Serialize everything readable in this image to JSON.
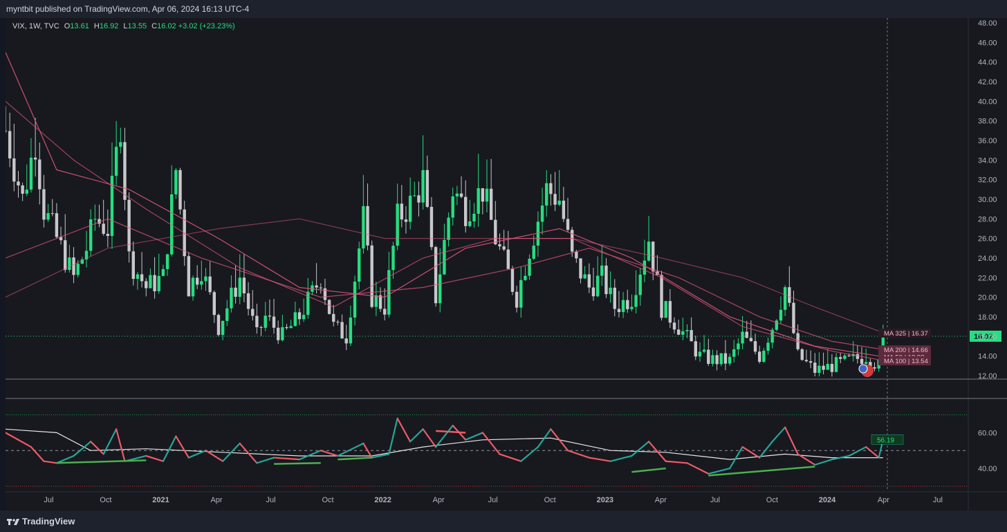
{
  "header": {
    "publish_line": "myntbit published on TradingView.com, Apr 06, 2024 16:13 UTC-4"
  },
  "legend": {
    "symbol": "VIX, 1W, TVC",
    "o_label": "O",
    "o_value": "13.61",
    "h_label": "H",
    "h_value": "16.92",
    "l_label": "L",
    "l_value": "13.55",
    "c_label": "C",
    "c_value": "16.02",
    "change": "+3.02 (+23.23%)"
  },
  "footer": {
    "brand": "TradingView"
  },
  "colors": {
    "bull": "#26de81",
    "bear": "#c8c8cc",
    "rsi_up": "#26a69a",
    "rsi_down": "#f05a67",
    "ma_line": "#e2557c",
    "price_line": "#26de81",
    "background": "#17191e"
  },
  "chart_data": [
    {
      "type": "candlestick",
      "title": "VIX, 1W, TVC",
      "y_ticks": [
        "12.00",
        "14.00",
        "16.00",
        "18.00",
        "20.00",
        "22.00",
        "24.00",
        "26.00",
        "28.00",
        "30.00",
        "32.00",
        "34.00",
        "36.00",
        "38.00",
        "40.00",
        "42.00",
        "44.00",
        "46.00",
        "48.00"
      ],
      "ylim": [
        11.5,
        48.5
      ],
      "x_ticks": [
        "Jul",
        "Oct",
        "2021",
        "Apr",
        "Jul",
        "Oct",
        "2022",
        "Apr",
        "Jul",
        "Oct",
        "2023",
        "Apr",
        "Jul",
        "Oct",
        "2024",
        "Apr",
        "Jul"
      ],
      "x_range": [
        "2020-04-20",
        "2024-08-19"
      ],
      "last_price": "16.02",
      "ma_labels": [
        {
          "name": "MA 325",
          "value": "16.37"
        },
        {
          "name": "MA 200",
          "value": "14.66"
        },
        {
          "name": "MA 50",
          "value": "13.93"
        },
        {
          "name": "MA 100",
          "value": "13.54"
        }
      ],
      "close_path": [
        [
          "2020-04-20",
          37
        ],
        [
          "2020-05-18",
          30
        ],
        [
          "2020-06-08",
          36
        ],
        [
          "2020-06-22",
          29
        ],
        [
          "2020-07-13",
          26
        ],
        [
          "2020-08-10",
          22
        ],
        [
          "2020-08-31",
          25
        ],
        [
          "2020-09-14",
          28
        ],
        [
          "2020-10-05",
          27
        ],
        [
          "2020-10-26",
          38
        ],
        [
          "2020-11-09",
          24
        ],
        [
          "2020-12-07",
          21
        ],
        [
          "2021-01-04",
          22
        ],
        [
          "2021-01-25",
          33
        ],
        [
          "2021-02-15",
          21
        ],
        [
          "2021-03-08",
          23
        ],
        [
          "2021-04-05",
          17
        ],
        [
          "2021-05-10",
          22
        ],
        [
          "2021-06-07",
          16
        ],
        [
          "2021-06-21",
          18
        ],
        [
          "2021-07-19",
          16
        ],
        [
          "2021-08-16",
          18
        ],
        [
          "2021-09-20",
          22
        ],
        [
          "2021-10-11",
          17
        ],
        [
          "2021-11-01",
          16
        ],
        [
          "2021-11-29",
          28
        ],
        [
          "2021-12-13",
          20
        ],
        [
          "2022-01-03",
          19
        ],
        [
          "2022-01-24",
          28
        ],
        [
          "2022-02-21",
          30
        ],
        [
          "2022-03-07",
          32
        ],
        [
          "2022-03-28",
          20
        ],
        [
          "2022-04-25",
          31
        ],
        [
          "2022-05-16",
          29
        ],
        [
          "2022-06-13",
          31
        ],
        [
          "2022-07-04",
          26
        ],
        [
          "2022-08-08",
          20
        ],
        [
          "2022-08-29",
          25
        ],
        [
          "2022-09-26",
          31
        ],
        [
          "2022-10-17",
          30
        ],
        [
          "2022-11-07",
          24
        ],
        [
          "2022-12-05",
          21
        ],
        [
          "2022-12-26",
          22
        ],
        [
          "2023-01-16",
          19
        ],
        [
          "2023-02-13",
          20
        ],
        [
          "2023-03-13",
          26
        ],
        [
          "2023-04-03",
          19
        ],
        [
          "2023-05-01",
          17
        ],
        [
          "2023-06-05",
          14
        ],
        [
          "2023-06-26",
          13.6
        ],
        [
          "2023-07-24",
          13.5
        ],
        [
          "2023-08-14",
          16
        ],
        [
          "2023-09-11",
          14
        ],
        [
          "2023-10-02",
          17
        ],
        [
          "2023-10-23",
          21
        ],
        [
          "2023-11-13",
          14
        ],
        [
          "2023-12-11",
          12.5
        ],
        [
          "2024-01-08",
          13
        ],
        [
          "2024-02-05",
          13.5
        ],
        [
          "2024-03-04",
          14
        ],
        [
          "2024-03-25",
          13.0
        ],
        [
          "2024-04-01",
          16.02
        ]
      ],
      "ma_paths": [
        {
          "name": "MA 325",
          "points": [
            [
              "2020-04-20",
              20
            ],
            [
              "2020-10-05",
              25
            ],
            [
              "2021-04-05",
              27
            ],
            [
              "2021-08-16",
              28
            ],
            [
              "2022-01-03",
              26
            ],
            [
              "2022-06-13",
              26
            ],
            [
              "2022-11-07",
              26
            ],
            [
              "2023-04-03",
              24
            ],
            [
              "2023-08-14",
              22
            ],
            [
              "2023-12-11",
              19
            ],
            [
              "2024-04-01",
              16.37
            ]
          ]
        },
        {
          "name": "MA 200",
          "points": [
            [
              "2020-04-20",
              24
            ],
            [
              "2020-10-05",
              28
            ],
            [
              "2021-03-08",
              24
            ],
            [
              "2021-09-20",
              20
            ],
            [
              "2022-03-07",
              21
            ],
            [
              "2022-08-08",
              23
            ],
            [
              "2022-12-05",
              25
            ],
            [
              "2023-05-01",
              22
            ],
            [
              "2023-09-11",
              18
            ],
            [
              "2024-01-08",
              15.5
            ],
            [
              "2024-04-01",
              14.66
            ]
          ]
        },
        {
          "name": "MA 50",
          "points": [
            [
              "2020-04-20",
              45
            ],
            [
              "2020-07-13",
              33
            ],
            [
              "2020-11-09",
              31
            ],
            [
              "2021-04-05",
              26
            ],
            [
              "2021-08-16",
              21
            ],
            [
              "2022-01-03",
              20
            ],
            [
              "2022-05-16",
              25
            ],
            [
              "2022-10-17",
              27
            ],
            [
              "2023-02-13",
              24
            ],
            [
              "2023-07-24",
              18
            ],
            [
              "2023-12-11",
              15
            ],
            [
              "2024-04-01",
              13.93
            ]
          ]
        },
        {
          "name": "MA 100",
          "points": [
            [
              "2020-04-20",
              40
            ],
            [
              "2020-08-10",
              34
            ],
            [
              "2020-12-07",
              29
            ],
            [
              "2021-05-10",
              23
            ],
            [
              "2021-10-11",
              19
            ],
            [
              "2022-03-07",
              24
            ],
            [
              "2022-07-04",
              26
            ],
            [
              "2022-11-07",
              26
            ],
            [
              "2023-04-03",
              22
            ],
            [
              "2023-08-14",
              17
            ],
            [
              "2024-01-08",
              14.5
            ],
            [
              "2024-04-01",
              13.54
            ]
          ]
        }
      ]
    },
    {
      "type": "line",
      "title": "RSI",
      "y_ticks": [
        "40.00",
        "60.00"
      ],
      "ylim": [
        28,
        78
      ],
      "upper_band": 70,
      "mid_band": 50,
      "lower_band": 30,
      "last_value": "56.19",
      "rsi_path": [
        [
          "2020-04-20",
          60
        ],
        [
          "2020-05-11",
          56
        ],
        [
          "2020-06-01",
          52
        ],
        [
          "2020-06-22",
          44
        ],
        [
          "2020-07-13",
          43
        ],
        [
          "2020-08-10",
          47
        ],
        [
          "2020-09-07",
          55
        ],
        [
          "2020-09-28",
          48
        ],
        [
          "2020-10-19",
          62
        ],
        [
          "2020-11-02",
          44
        ],
        [
          "2020-12-07",
          47
        ],
        [
          "2021-01-04",
          44
        ],
        [
          "2021-01-25",
          58
        ],
        [
          "2021-02-15",
          46
        ],
        [
          "2021-03-15",
          50
        ],
        [
          "2021-04-12",
          44
        ],
        [
          "2021-05-10",
          54
        ],
        [
          "2021-06-07",
          43
        ],
        [
          "2021-07-05",
          46
        ],
        [
          "2021-08-16",
          45
        ],
        [
          "2021-09-20",
          50
        ],
        [
          "2021-10-18",
          47
        ],
        [
          "2021-11-29",
          54
        ],
        [
          "2021-12-13",
          46
        ],
        [
          "2022-01-10",
          48
        ],
        [
          "2022-01-24",
          68
        ],
        [
          "2022-02-14",
          55
        ],
        [
          "2022-03-07",
          62
        ],
        [
          "2022-03-28",
          52
        ],
        [
          "2022-04-25",
          64
        ],
        [
          "2022-05-16",
          56
        ],
        [
          "2022-06-13",
          60
        ],
        [
          "2022-07-11",
          48
        ],
        [
          "2022-08-15",
          44
        ],
        [
          "2022-09-12",
          52
        ],
        [
          "2022-10-03",
          62
        ],
        [
          "2022-10-31",
          50
        ],
        [
          "2022-12-05",
          46
        ],
        [
          "2023-01-09",
          44
        ],
        [
          "2023-02-13",
          47
        ],
        [
          "2023-03-13",
          55
        ],
        [
          "2023-04-10",
          44
        ],
        [
          "2023-05-15",
          43
        ],
        [
          "2023-06-19",
          37
        ],
        [
          "2023-07-24",
          40
        ],
        [
          "2023-08-14",
          52
        ],
        [
          "2023-09-11",
          46
        ],
        [
          "2023-10-02",
          55
        ],
        [
          "2023-10-23",
          63
        ],
        [
          "2023-11-13",
          48
        ],
        [
          "2023-12-11",
          42
        ],
        [
          "2024-01-08",
          45
        ],
        [
          "2024-02-05",
          47
        ],
        [
          "2024-03-04",
          52
        ],
        [
          "2024-03-25",
          46
        ],
        [
          "2024-04-01",
          56.19
        ]
      ],
      "signal_path": [
        [
          "2020-04-20",
          62
        ],
        [
          "2020-07-13",
          60
        ],
        [
          "2020-09-07",
          50
        ],
        [
          "2020-12-07",
          51
        ],
        [
          "2021-04-12",
          49
        ],
        [
          "2021-08-16",
          47
        ],
        [
          "2021-12-13",
          47
        ],
        [
          "2022-03-07",
          52
        ],
        [
          "2022-06-13",
          56
        ],
        [
          "2022-10-03",
          57
        ],
        [
          "2023-01-09",
          50
        ],
        [
          "2023-04-10",
          49
        ],
        [
          "2023-07-24",
          45
        ],
        [
          "2023-10-23",
          48
        ],
        [
          "2024-01-08",
          46
        ],
        [
          "2024-04-01",
          46
        ]
      ],
      "divergence_lines": [
        [
          [
            "2020-07-13",
            43
          ],
          [
            "2020-12-07",
            44.5
          ]
        ],
        [
          [
            "2021-07-05",
            42.5
          ],
          [
            "2021-09-20",
            43
          ]
        ],
        [
          [
            "2021-10-18",
            45
          ],
          [
            "2021-12-13",
            46
          ]
        ],
        [
          [
            "2022-03-28",
            61
          ],
          [
            "2022-05-16",
            60
          ]
        ],
        [
          [
            "2023-02-13",
            38
          ],
          [
            "2023-04-10",
            40
          ]
        ],
        [
          [
            "2023-06-19",
            36
          ],
          [
            "2023-12-11",
            41
          ]
        ]
      ]
    }
  ]
}
